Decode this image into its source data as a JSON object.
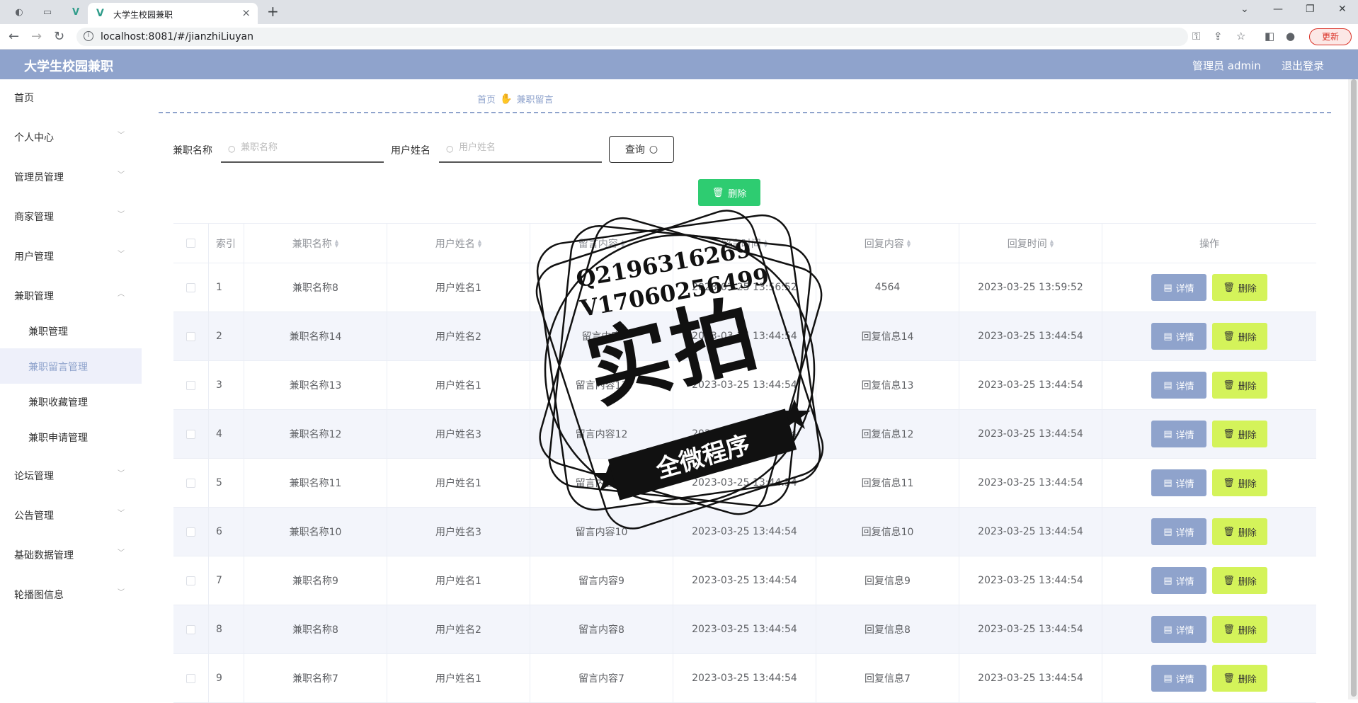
{
  "browser": {
    "tab_title": "大学生校园兼职",
    "url": "localhost:8081/#/jianzhiLiuyan",
    "update_label": "更新"
  },
  "header": {
    "title": "大学生校园兼职",
    "user": "管理员 admin",
    "logout": "退出登录"
  },
  "sidebar": {
    "items": [
      {
        "label": "首页"
      },
      {
        "label": "个人中心"
      },
      {
        "label": "管理员管理"
      },
      {
        "label": "商家管理"
      },
      {
        "label": "用户管理"
      },
      {
        "label": "兼职管理"
      },
      {
        "label": "论坛管理"
      },
      {
        "label": "公告管理"
      },
      {
        "label": "基础数据管理"
      },
      {
        "label": "轮播图信息"
      }
    ],
    "subitems": [
      {
        "label": "兼职管理"
      },
      {
        "label": "兼职留言管理"
      },
      {
        "label": "兼职收藏管理"
      },
      {
        "label": "兼职申请管理"
      }
    ]
  },
  "breadcrumb": {
    "home": "首页",
    "current": "兼职留言"
  },
  "search": {
    "field1_label": "兼职名称",
    "field1_placeholder": "兼职名称",
    "field2_label": "用户姓名",
    "field2_placeholder": "用户姓名",
    "query_label": "查询"
  },
  "actions": {
    "delete_label": "删除"
  },
  "table": {
    "headers": [
      "索引",
      "兼职名称",
      "用户姓名",
      "留言内容",
      "留言时间",
      "回复内容",
      "回复时间",
      "操作"
    ],
    "detail_label": "详情",
    "delete_label": "删除",
    "rows": [
      {
        "index": "1",
        "name": "兼职名称8",
        "user": "用户姓名1",
        "content": "",
        "time": "2023-03-25 13:56:52",
        "reply": "4564",
        "reply_time": "2023-03-25 13:59:52"
      },
      {
        "index": "2",
        "name": "兼职名称14",
        "user": "用户姓名2",
        "content": "留言内容",
        "time": "2023-03-25 13:44:54",
        "reply": "回复信息14",
        "reply_time": "2023-03-25 13:44:54"
      },
      {
        "index": "3",
        "name": "兼职名称13",
        "user": "用户姓名1",
        "content": "留言内容13",
        "time": "2023-03-25 13:44:54",
        "reply": "回复信息13",
        "reply_time": "2023-03-25 13:44:54"
      },
      {
        "index": "4",
        "name": "兼职名称12",
        "user": "用户姓名3",
        "content": "留言内容12",
        "time": "2023-03-25 13:44:54",
        "reply": "回复信息12",
        "reply_time": "2023-03-25 13:44:54"
      },
      {
        "index": "5",
        "name": "兼职名称11",
        "user": "用户姓名1",
        "content": "留言内容11",
        "time": "2023-03-25 13:44:54",
        "reply": "回复信息11",
        "reply_time": "2023-03-25 13:44:54"
      },
      {
        "index": "6",
        "name": "兼职名称10",
        "user": "用户姓名3",
        "content": "留言内容10",
        "time": "2023-03-25 13:44:54",
        "reply": "回复信息10",
        "reply_time": "2023-03-25 13:44:54"
      },
      {
        "index": "7",
        "name": "兼职名称9",
        "user": "用户姓名1",
        "content": "留言内容9",
        "time": "2023-03-25 13:44:54",
        "reply": "回复信息9",
        "reply_time": "2023-03-25 13:44:54"
      },
      {
        "index": "8",
        "name": "兼职名称8",
        "user": "用户姓名2",
        "content": "留言内容8",
        "time": "2023-03-25 13:44:54",
        "reply": "回复信息8",
        "reply_time": "2023-03-25 13:44:54"
      },
      {
        "index": "9",
        "name": "兼职名称7",
        "user": "用户姓名1",
        "content": "留言内容7",
        "time": "2023-03-25 13:44:54",
        "reply": "回复信息7",
        "reply_time": "2023-03-25 13:44:54"
      }
    ]
  },
  "watermark": {
    "line1": "Q2196316269",
    "line2": "V17060256499",
    "big": "实拍",
    "ribbon": "全微程序"
  },
  "colors": {
    "accent": "#8fa3cc",
    "green": "#2ecc71",
    "lime": "#d4f35a"
  }
}
